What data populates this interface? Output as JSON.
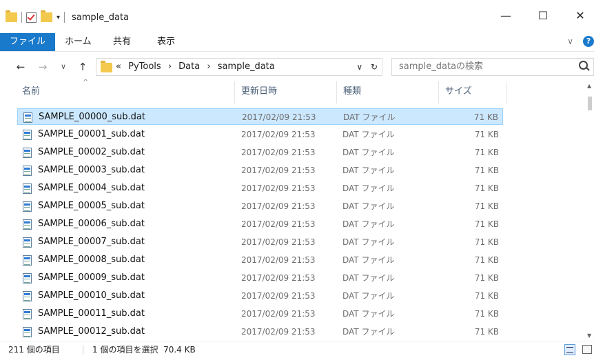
{
  "window": {
    "title": "sample_data",
    "minimize": "—",
    "maximize": "☐",
    "close": "✕"
  },
  "qat": {
    "dropdown": "▾"
  },
  "ribbon": {
    "tabs": [
      "ファイル",
      "ホーム",
      "共有",
      "表示"
    ],
    "collapse_glyph": "∨",
    "help_glyph": "?"
  },
  "nav": {
    "back": "←",
    "forward": "→",
    "recent": "∨",
    "up": "↑"
  },
  "address": {
    "overflow": "«",
    "separator": "›",
    "segments": [
      "PyTools",
      "Data",
      "sample_data"
    ],
    "dropdown": "∨",
    "refresh": "↻"
  },
  "search": {
    "placeholder": "sample_dataの検索"
  },
  "columns": {
    "name": "名前",
    "date": "更新日時",
    "type": "種類",
    "size": "サイズ",
    "sort_indicator": "^"
  },
  "files": [
    {
      "name": "SAMPLE_00000_sub.dat",
      "date": "2017/02/09 21:53",
      "type": "DAT ファイル",
      "size": "71 KB",
      "selected": true
    },
    {
      "name": "SAMPLE_00001_sub.dat",
      "date": "2017/02/09 21:53",
      "type": "DAT ファイル",
      "size": "71 KB"
    },
    {
      "name": "SAMPLE_00002_sub.dat",
      "date": "2017/02/09 21:53",
      "type": "DAT ファイル",
      "size": "71 KB"
    },
    {
      "name": "SAMPLE_00003_sub.dat",
      "date": "2017/02/09 21:53",
      "type": "DAT ファイル",
      "size": "71 KB"
    },
    {
      "name": "SAMPLE_00004_sub.dat",
      "date": "2017/02/09 21:53",
      "type": "DAT ファイル",
      "size": "71 KB"
    },
    {
      "name": "SAMPLE_00005_sub.dat",
      "date": "2017/02/09 21:53",
      "type": "DAT ファイル",
      "size": "71 KB"
    },
    {
      "name": "SAMPLE_00006_sub.dat",
      "date": "2017/02/09 21:53",
      "type": "DAT ファイル",
      "size": "71 KB"
    },
    {
      "name": "SAMPLE_00007_sub.dat",
      "date": "2017/02/09 21:53",
      "type": "DAT ファイル",
      "size": "71 KB"
    },
    {
      "name": "SAMPLE_00008_sub.dat",
      "date": "2017/02/09 21:53",
      "type": "DAT ファイル",
      "size": "71 KB"
    },
    {
      "name": "SAMPLE_00009_sub.dat",
      "date": "2017/02/09 21:53",
      "type": "DAT ファイル",
      "size": "71 KB"
    },
    {
      "name": "SAMPLE_00010_sub.dat",
      "date": "2017/02/09 21:53",
      "type": "DAT ファイル",
      "size": "71 KB"
    },
    {
      "name": "SAMPLE_00011_sub.dat",
      "date": "2017/02/09 21:53",
      "type": "DAT ファイル",
      "size": "71 KB"
    },
    {
      "name": "SAMPLE_00012_sub.dat",
      "date": "2017/02/09 21:53",
      "type": "DAT ファイル",
      "size": "71 KB"
    }
  ],
  "status": {
    "item_count": "211 個の項目",
    "selection": "1 個の項目を選択  70.4 KB"
  },
  "icons": {
    "folder": "folder-icon",
    "file": "dat-file-icon",
    "search": "search-icon",
    "details_view": "details-view-icon",
    "large_icons_view": "large-icons-view-icon"
  },
  "colors": {
    "accent": "#1979ca",
    "selection_bg": "#cce8ff",
    "selection_border": "#99d1ff",
    "folder": "#f2c94c"
  }
}
